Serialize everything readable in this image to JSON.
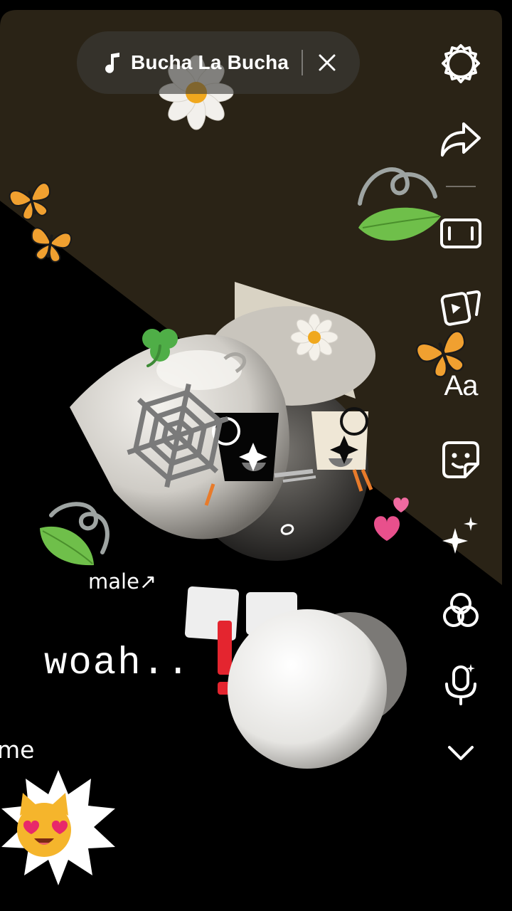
{
  "music": {
    "song_title": "Bucha La Bucha",
    "note_icon": "music-note-icon",
    "close_icon": "close-icon"
  },
  "toolbar": {
    "items": [
      {
        "name": "settings",
        "icon": "gear-icon"
      },
      {
        "name": "share",
        "icon": "forward-arrow-icon"
      },
      {
        "name": "crop",
        "icon": "aspect-ratio-icon"
      },
      {
        "name": "clips",
        "icon": "video-clips-icon"
      },
      {
        "name": "text",
        "label": "Aa"
      },
      {
        "name": "stickers",
        "icon": "sticker-icon"
      },
      {
        "name": "effects",
        "icon": "sparkles-icon"
      },
      {
        "name": "filters",
        "icon": "filters-icon"
      },
      {
        "name": "voice",
        "icon": "microphone-icon"
      },
      {
        "name": "more",
        "icon": "chevron-down-icon"
      }
    ]
  },
  "overlay_text": {
    "male": "male↗",
    "woah": "woah..",
    "me": "me"
  },
  "stickers": [
    "flower-icon",
    "flower-icon",
    "butterfly-icon",
    "butterfly-icon",
    "butterfly-icon",
    "leaf-icon",
    "leaf-icon",
    "swirl-icon",
    "swirl-icon",
    "clover-icon",
    "spiderweb-icon",
    "hearts-icon",
    "sparkle-icon",
    "cat-heart-eyes-icon",
    "exclamation-icon"
  ],
  "colors": {
    "background_top": "#2a2316",
    "background_bottom": "#000000",
    "pill": "#3c3c38",
    "icon": "#ffffff",
    "leaf": "#6fbf4a",
    "butterfly": "#f0a030",
    "heart": "#e8508c"
  }
}
